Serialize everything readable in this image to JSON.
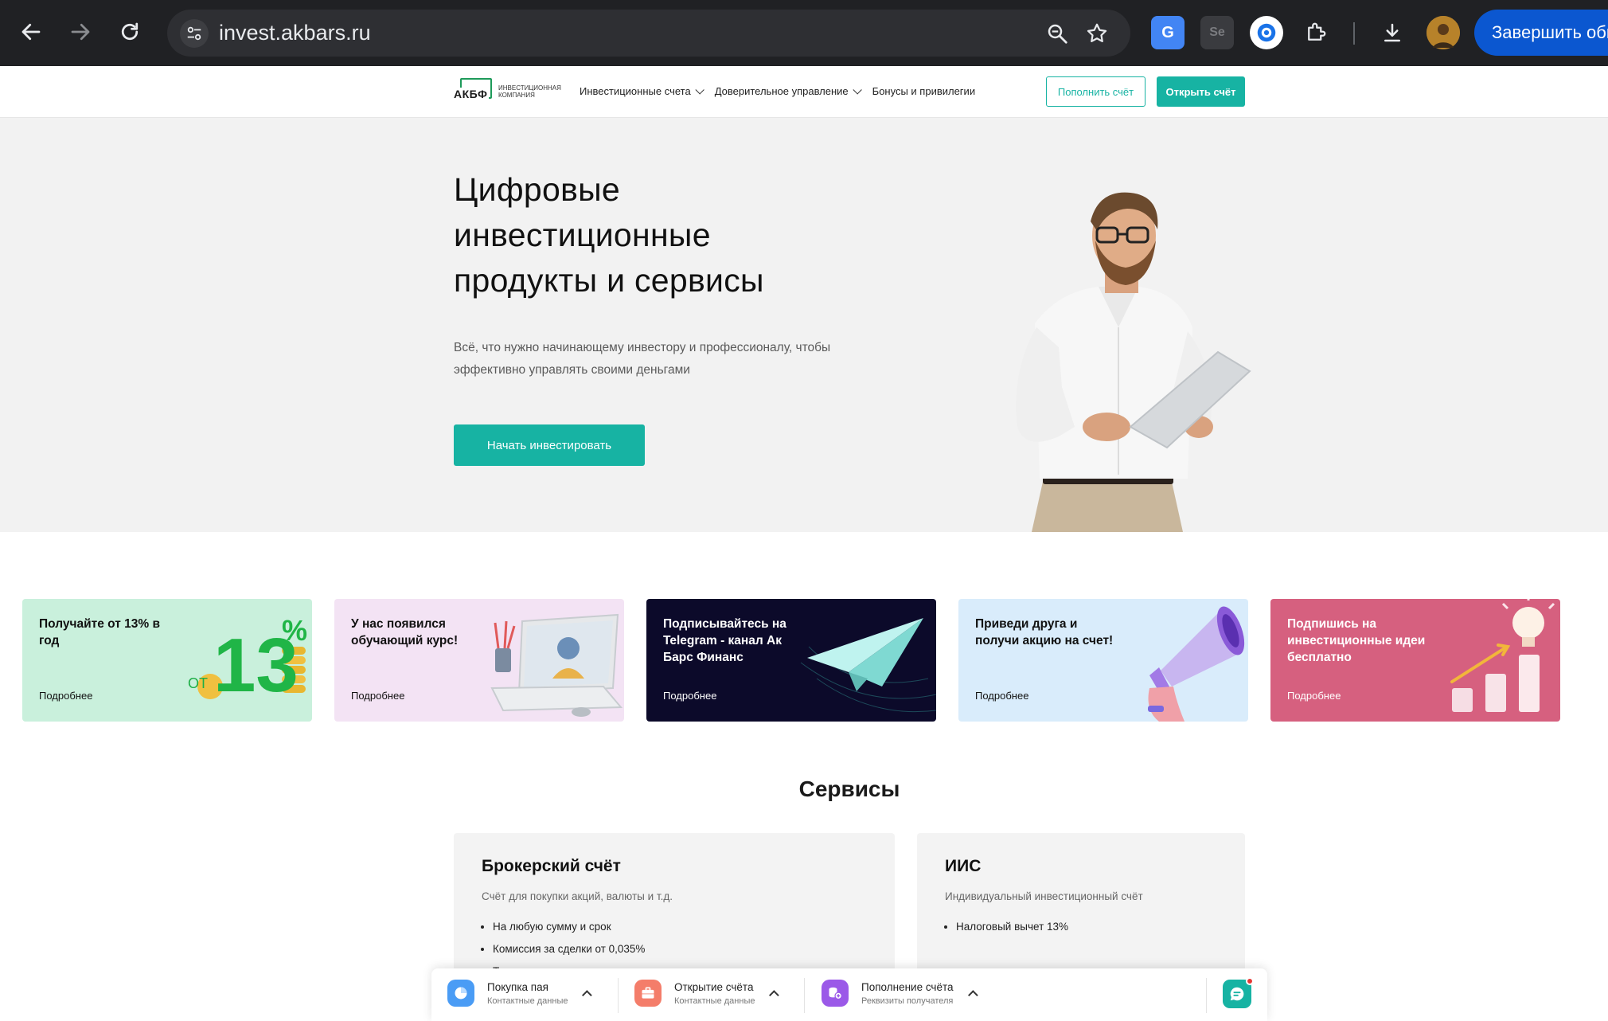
{
  "browser": {
    "url": "invest.akbars.ru",
    "update_button": "Завершить обн"
  },
  "header": {
    "logo_text": "АКБФ",
    "logo_subtitle": "Инвестиционная компания",
    "nav": [
      {
        "label": "Инвестиционные счета",
        "has_dropdown": true
      },
      {
        "label": "Доверительное управление",
        "has_dropdown": true
      },
      {
        "label": "Бонусы и привилегии",
        "has_dropdown": false
      }
    ],
    "topup_button": "Пополнить счёт",
    "open_button": "Открыть счёт"
  },
  "hero": {
    "title_lines": [
      "Цифровые",
      "инвестиционные",
      "продукты и сервисы"
    ],
    "desc_lines": [
      "Всё, что нужно начинающему инвестору и профессионалу, чтобы",
      "эффективно управлять своими деньгами"
    ],
    "cta": "Начать инвестировать"
  },
  "promos": [
    {
      "title": "Получайте от 13% в год",
      "more": "Подробнее",
      "bg": "#c9f0dc",
      "fg": "#111111",
      "art_prefix": "ОТ",
      "art_number": "13",
      "art_percent": "%"
    },
    {
      "title": "У нас появился обучающий  курс!",
      "more": "Подробнее",
      "bg": "#f3e3f4",
      "fg": "#111111"
    },
    {
      "title": "Подписывайтесь на Telegram - канал Ак Барс Финанс",
      "more": "Подробнее",
      "bg": "#0c0a2a",
      "fg": "#ffffff"
    },
    {
      "title": "Приведи друга и получи акцию на счет!",
      "more": "Подробнее",
      "bg": "#d9ecfb",
      "fg": "#111111"
    },
    {
      "title": "Подпишись на инвестиционные идеи бесплатно",
      "more": "Подробнее",
      "bg": "#d6607f",
      "fg": "#ffffff"
    }
  ],
  "services": {
    "title": "Сервисы",
    "cards": [
      {
        "title": "Брокерский счёт",
        "desc": "Счёт для покупки акций, валюты и т.д.",
        "items": [
          "На любую сумму и срок",
          "Комиссия за сделки от 0,035%",
          "Торговля с кредитным плечом"
        ]
      },
      {
        "title": "ИИС",
        "desc": "Индивидуальный инвестиционный счёт",
        "items": [
          "Налоговый вычет 13%"
        ]
      }
    ]
  },
  "action_bar": {
    "actions": [
      {
        "title": "Покупка пая",
        "subtitle": "Контактные данные",
        "color": "#4a9cf5",
        "icon": "pie-chart-icon"
      },
      {
        "title": "Открытие счёта",
        "subtitle": "Контактные данные",
        "color": "#f47d6a",
        "icon": "briefcase-icon"
      },
      {
        "title": "Пополнение счёта",
        "subtitle": "Реквизиты получателя",
        "color": "#9b59e8",
        "icon": "coins-add-icon"
      }
    ]
  },
  "colors": {
    "accent": "#17b3a3",
    "chrome_bg": "#202124",
    "hero_bg": "#f2f2f2"
  }
}
